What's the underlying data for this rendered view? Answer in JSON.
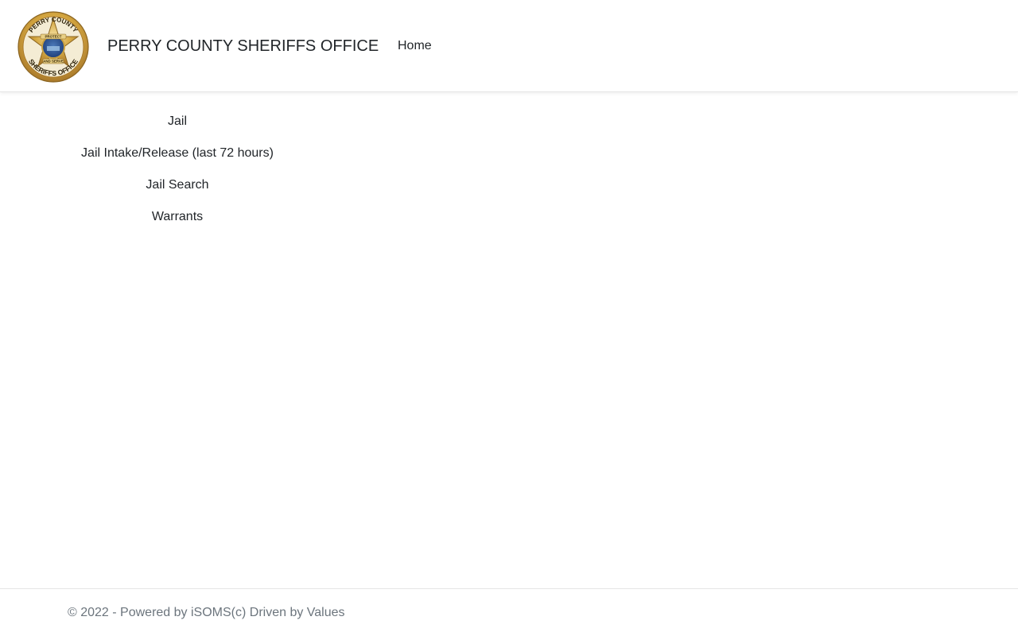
{
  "header": {
    "logo_icon": "sheriff-star-badge-icon",
    "logo_text": {
      "top": "PERRY COUNTY",
      "bottom": "SHERIFFS OFFICE",
      "ribbon_top": "PROTECT",
      "ribbon_bottom": "AND SERVE"
    },
    "brand": "PERRY COUNTY SHERIFFS OFFICE",
    "nav": [
      {
        "label": "Home"
      }
    ]
  },
  "menu": {
    "items": [
      {
        "label": "Jail"
      },
      {
        "label": "Jail Intake/Release (last 72 hours)"
      },
      {
        "label": "Jail Search"
      },
      {
        "label": "Warrants"
      }
    ]
  },
  "footer": {
    "text": "© 2022 - Powered by iSOMS(c) Driven by Values"
  },
  "colors": {
    "text": "#212529",
    "muted": "#6c757d",
    "border": "#e5e5e5",
    "badge_gold": "#d4a640",
    "badge_blue": "#1f3f7a"
  }
}
